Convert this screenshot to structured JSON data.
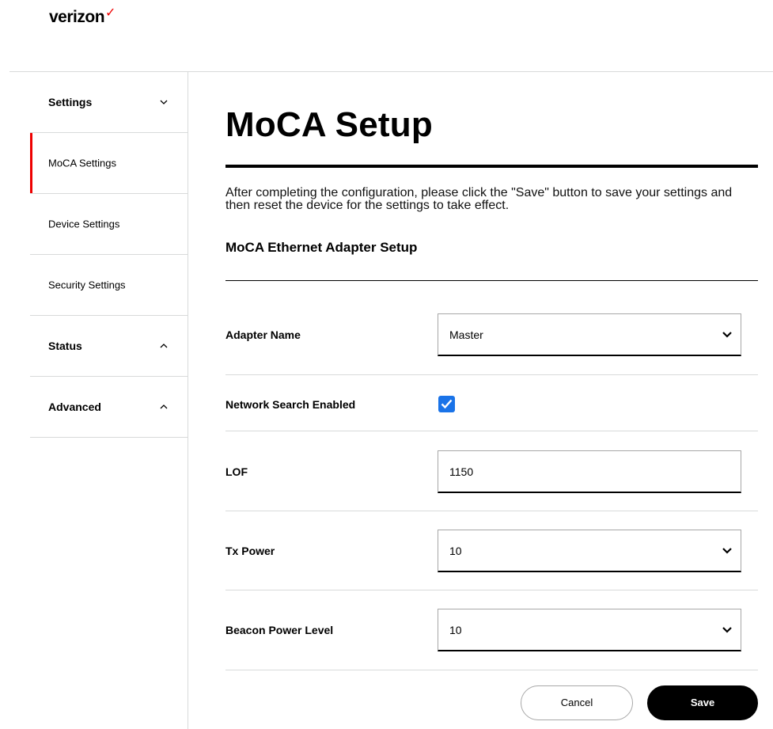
{
  "brand": {
    "name": "verizon",
    "mark": "✓",
    "accent": "#ee0000"
  },
  "sidebar": {
    "items": [
      {
        "label": "Settings",
        "type": "section",
        "chevron": "down"
      },
      {
        "label": "MoCA Settings",
        "type": "link",
        "active": true
      },
      {
        "label": "Device Settings",
        "type": "link"
      },
      {
        "label": "Security Settings",
        "type": "link"
      },
      {
        "label": "Status",
        "type": "section",
        "chevron": "up"
      },
      {
        "label": "Advanced",
        "type": "section",
        "chevron": "up"
      }
    ]
  },
  "main": {
    "title": "MoCA Setup",
    "intro": "After completing the configuration, please click the \"Save\" button to save your settings and then reset the device for the settings to take effect.",
    "subheading": "MoCA Ethernet Adapter Setup",
    "fields": {
      "adapter_name": {
        "label": "Adapter Name",
        "value": "Master"
      },
      "network_search": {
        "label": "Network Search Enabled",
        "checked": true,
        "color": "#1a73e8"
      },
      "lof": {
        "label": "LOF",
        "value": "1150"
      },
      "tx_power": {
        "label": "Tx Power",
        "value": "10"
      },
      "beacon_power": {
        "label": "Beacon Power Level",
        "value": "10"
      }
    }
  },
  "actions": {
    "cancel_label": "Cancel",
    "save_label": "Save"
  }
}
